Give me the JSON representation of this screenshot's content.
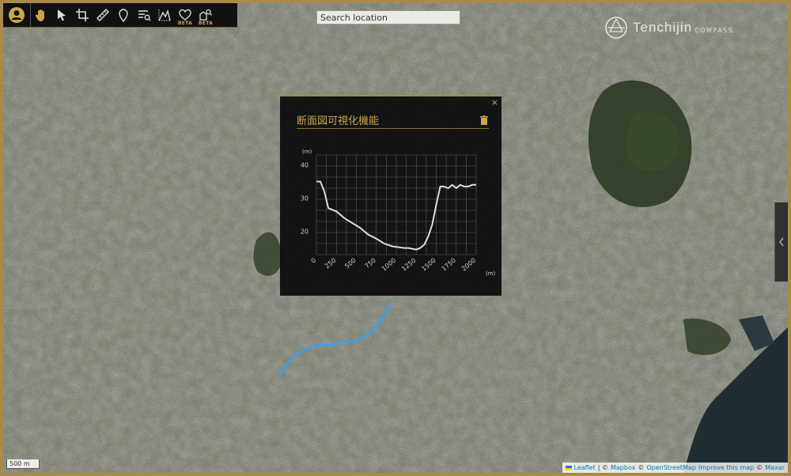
{
  "search": {
    "placeholder": "Search location"
  },
  "logo": {
    "name": "Tenchijin",
    "sub": "COMPASS"
  },
  "toolbar": {
    "tools": [
      {
        "icon": "hand-icon"
      },
      {
        "icon": "pointer-icon"
      },
      {
        "icon": "crop-icon"
      },
      {
        "icon": "ruler-icon"
      },
      {
        "icon": "pin-icon"
      },
      {
        "icon": "layer-search-icon"
      },
      {
        "icon": "profile-icon"
      },
      {
        "icon": "heart-pin-icon",
        "badge": "BETA"
      },
      {
        "icon": "building-search-icon",
        "badge": "BETA"
      }
    ]
  },
  "popup": {
    "title": "断面図可視化機能",
    "close": "×"
  },
  "chart_data": {
    "type": "line",
    "title": "",
    "xlabel": "(m)",
    "ylabel": "(m)",
    "xlim": [
      0,
      2000
    ],
    "ylim": [
      13,
      43
    ],
    "xticks": [
      0,
      250,
      500,
      750,
      1000,
      1250,
      1500,
      1750,
      2000
    ],
    "yticks": [
      20,
      30,
      40
    ],
    "grid": true,
    "series": [
      {
        "color": "#dddddd",
        "x": [
          0,
          50,
          100,
          150,
          250,
          350,
          450,
          550,
          650,
          750,
          850,
          950,
          1000,
          1100,
          1150,
          1250,
          1300,
          1350,
          1400,
          1450,
          1500,
          1550,
          1600,
          1650,
          1700,
          1750,
          1800,
          1850,
          1900,
          1950,
          2000
        ],
        "y": [
          35,
          35,
          32,
          27,
          26,
          24,
          22.5,
          21,
          19,
          17.8,
          16.3,
          15.5,
          15.3,
          15,
          15,
          14.5,
          15,
          16,
          18.5,
          22,
          28,
          33.5,
          33.5,
          33,
          34,
          33,
          34,
          33.5,
          33.5,
          34,
          34
        ]
      }
    ]
  },
  "scale": {
    "label": "500 m"
  },
  "attribution": {
    "leaflet": "Leaflet",
    "sep1": "| ©",
    "mapbox": "Mapbox",
    "sep2": "©",
    "osm": "OpenStreetMap",
    "improve": "Improve this map",
    "sep3": "©",
    "maxar": "Maxar"
  },
  "colors": {
    "accent": "#c9a64d",
    "route": "#3fa0e6"
  }
}
